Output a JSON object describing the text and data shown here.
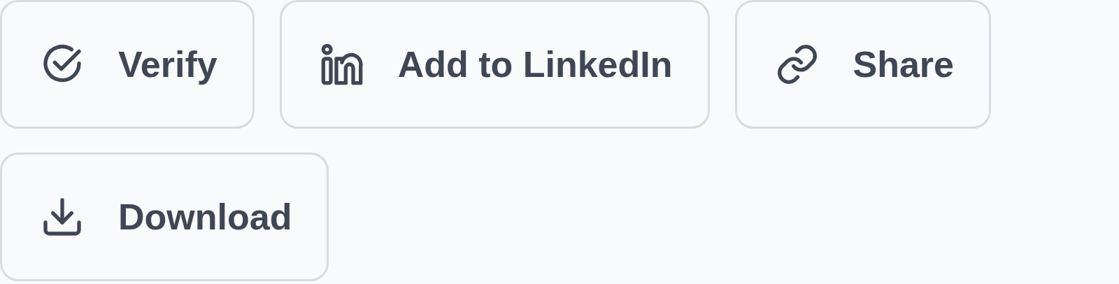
{
  "buttons": [
    {
      "kind": "verify",
      "label": "Verify"
    },
    {
      "kind": "linkedin",
      "label": "Add to LinkedIn"
    },
    {
      "kind": "share",
      "label": "Share"
    },
    {
      "kind": "download",
      "label": "Download"
    }
  ]
}
